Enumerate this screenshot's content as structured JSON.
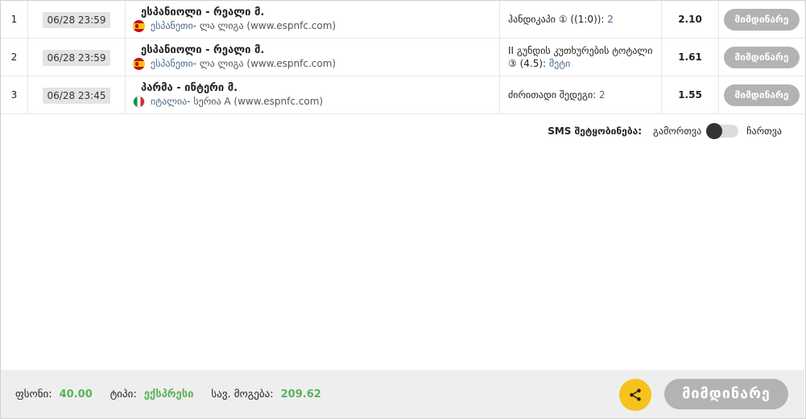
{
  "rows": [
    {
      "num": "1",
      "date": "06/28 23:59",
      "match": "ესპანიოლი - რეალი მ.",
      "country": "ესპანეთი",
      "league": " - ლა ლიგა (www.espnfc.com)",
      "flag": "spain-flag-icon",
      "selection_label": "ჰანდიკაპი ① ((1:0)): ",
      "selection_value": "2",
      "odd": "2.10",
      "status": "მიმდინარე"
    },
    {
      "num": "2",
      "date": "06/28 23:59",
      "match": "ესპანიოლი - რეალი მ.",
      "country": "ესპანეთი",
      "league": " - ლა ლიგა (www.espnfc.com)",
      "flag": "spain-flag-icon",
      "selection_label": "II გუნდის კუთხურების ტოტალი ③ (4.5): ",
      "selection_value": "მეტი",
      "odd": "1.61",
      "status": "მიმდინარე"
    },
    {
      "num": "3",
      "date": "06/28 23:45",
      "match": "პარმა - ინტერი მ.",
      "country": "იტალია",
      "league": " - სერია A (www.espnfc.com)",
      "flag": "italy-flag-icon",
      "selection_label": "ძირითადი შედეგი: ",
      "selection_value": "2",
      "odd": "1.55",
      "status": "მიმდინარე"
    }
  ],
  "sms": {
    "label": "SMS შეტყობინება:",
    "off": "გამორთვა",
    "on": "ჩართვა",
    "enabled": false
  },
  "footer": {
    "stake_label": "ფსონი:",
    "stake_value": "40.00",
    "type_label": "ტიპი:",
    "type_value": "ექსპრესი",
    "win_label": "სავ. მოგება:",
    "win_value": "209.62",
    "share_icon": "share-icon",
    "status_button": "მიმდინარე"
  },
  "colors": {
    "accent_green": "#5ab45a",
    "share_yellow": "#f6c21c",
    "pill_gray": "#b3b3b3",
    "link_blue": "#4a6a8a"
  }
}
